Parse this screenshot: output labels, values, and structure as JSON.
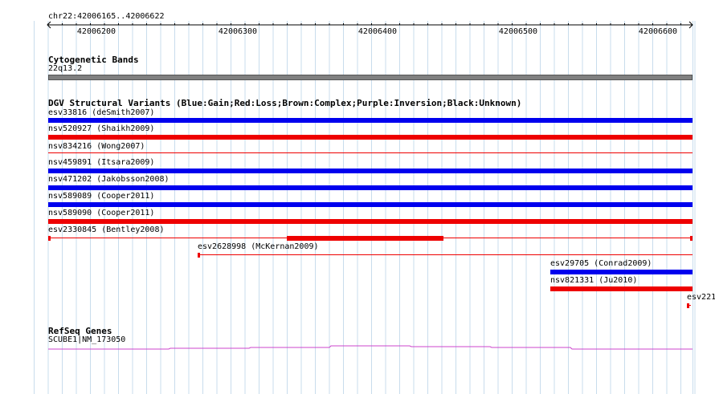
{
  "ruler": {
    "region": "chr22:42006165..42006622",
    "ticks": [
      "42006200",
      "42006300",
      "42006400",
      "42006500",
      "42006600"
    ]
  },
  "cytoband": {
    "title": "Cytogenetic Bands",
    "band": "22q13.2"
  },
  "dgv": {
    "title": "DGV Structural Variants (Blue:Gain;Red:Loss;Brown:Complex;Purple:Inversion;Black:Unknown)",
    "variants": [
      {
        "label": "esv33816 (deSmith2007)",
        "type": "gain"
      },
      {
        "label": "nsv520927 (Shaikh2009)",
        "type": "loss"
      },
      {
        "label": "nsv834216 (Wong2007)",
        "type": "loss"
      },
      {
        "label": "nsv459891 (Itsara2009)",
        "type": "gain"
      },
      {
        "label": "nsv471202 (Jakobsson2008)",
        "type": "gain"
      },
      {
        "label": "nsv589089 (Cooper2011)",
        "type": "gain"
      },
      {
        "label": "nsv589090 (Cooper2011)",
        "type": "loss"
      },
      {
        "label": "esv2330845 (Bentley2008)",
        "type": "loss"
      },
      {
        "label": "esv2628998 (McKernan2009)",
        "type": "loss"
      },
      {
        "label": "esv29705 (Conrad2009)",
        "type": "gain"
      },
      {
        "label": "nsv821331 (Ju2010)",
        "type": "loss"
      },
      {
        "label": "esv221",
        "type": "loss"
      }
    ]
  },
  "refseq": {
    "title": "RefSeq Genes",
    "gene": "SCUBE1|NM_173050"
  },
  "colors": {
    "gain": "#0000ee",
    "loss": "#ee0000",
    "grid": "#c8dcec",
    "band": "#808080",
    "gene": "#cc44cc"
  }
}
